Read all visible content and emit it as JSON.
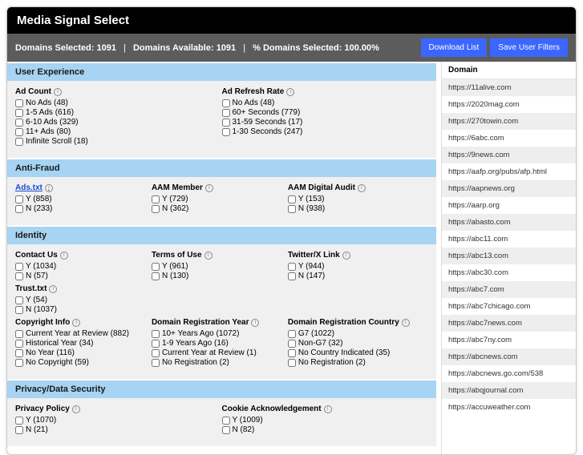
{
  "header": {
    "title": "Media Signal Select"
  },
  "stats": {
    "selected_label": "Domains Selected:",
    "selected_value": "1091",
    "available_label": "Domains Available:",
    "available_value": "1091",
    "percent_label": "% Domains Selected:",
    "percent_value": "100.00%"
  },
  "buttons": {
    "download": "Download List",
    "save_filters": "Save User Filters"
  },
  "sections": {
    "ux": {
      "title": "User Experience",
      "ad_count": {
        "label": "Ad Count",
        "options": [
          "No Ads (48)",
          "1-5 Ads (616)",
          "6-10 Ads (329)",
          "11+ Ads (80)",
          "Infinite Scroll (18)"
        ]
      },
      "ad_refresh": {
        "label": "Ad Refresh Rate",
        "options": [
          "No Ads (48)",
          "60+ Seconds (779)",
          "31-59 Seconds (17)",
          "1-30 Seconds (247)"
        ]
      }
    },
    "fraud": {
      "title": "Anti-Fraud",
      "adstxt": {
        "label": "Ads.txt",
        "link": true,
        "options": [
          "Y (858)",
          "N (233)"
        ]
      },
      "aam_member": {
        "label": "AAM Member",
        "options": [
          "Y (729)",
          "N (362)"
        ]
      },
      "aam_audit": {
        "label": "AAM Digital Audit",
        "options": [
          "Y (153)",
          "N (938)"
        ]
      }
    },
    "identity": {
      "title": "Identity",
      "contact": {
        "label": "Contact Us",
        "options": [
          "Y (1034)",
          "N (57)"
        ]
      },
      "terms": {
        "label": "Terms of Use",
        "options": [
          "Y (961)",
          "N (130)"
        ]
      },
      "twitter": {
        "label": "Twitter/X Link",
        "options": [
          "Y (944)",
          "N (147)"
        ]
      },
      "trust": {
        "label": "Trust.txt",
        "options": [
          "Y (54)",
          "N (1037)"
        ]
      },
      "copyright": {
        "label": "Copyright Info",
        "options": [
          "Current Year at Review (882)",
          "Historical Year (34)",
          "No Year (116)",
          "No Copyright (59)"
        ]
      },
      "regyear": {
        "label": "Domain Registration Year",
        "options": [
          "10+ Years Ago (1072)",
          "1-9 Years Ago (16)",
          "Current Year at Review (1)",
          "No Registration (2)"
        ]
      },
      "regcountry": {
        "label": "Domain Registration Country",
        "options": [
          "G7 (1022)",
          "Non-G7 (32)",
          "No Country Indicated (35)",
          "No Registration (2)"
        ]
      }
    },
    "privacy": {
      "title": "Privacy/Data Security",
      "policy": {
        "label": "Privacy Policy",
        "options": [
          "Y (1070)",
          "N (21)"
        ]
      },
      "cookie": {
        "label": "Cookie Acknowledgement",
        "options": [
          "Y (1009)",
          "N (82)"
        ]
      }
    }
  },
  "domains": {
    "header": "Domain",
    "list": [
      "https://11alive.com",
      "https://2020mag.com",
      "https://270towin.com",
      "https://6abc.com",
      "https://9news.com",
      "https://aafp.org/pubs/afp.html",
      "https://aapnews.org",
      "https://aarp.org",
      "https://abasto.com",
      "https://abc11.com",
      "https://abc13.com",
      "https://abc30.com",
      "https://abc7.com",
      "https://abc7chicago.com",
      "https://abc7news.com",
      "https://abc7ny.com",
      "https://abcnews.com",
      "https://abcnews.go.com/538",
      "https://abqjournal.com",
      "https://accuweather.com"
    ]
  }
}
